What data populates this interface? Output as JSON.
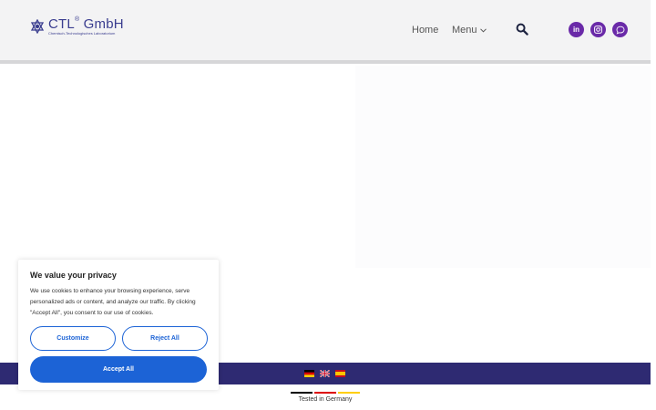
{
  "header": {
    "logo": {
      "title": "CTL",
      "registered": "®",
      "suffix": " GmbH",
      "subtitle": "Chemisch-Technologisches Laboratorium"
    },
    "nav": {
      "home": "Home",
      "menu": "Menu"
    },
    "icons": {
      "search": "search-icon",
      "linkedin": "linkedin-icon",
      "instagram": "instagram-icon",
      "chat": "chat-icon"
    },
    "linkedin_label": "in"
  },
  "colors": {
    "brand": "#3a3d8f",
    "social": "#6a2aa8",
    "footer": "#2e2a72",
    "accent": "#1c63d6"
  },
  "footer": {
    "languages": [
      "de",
      "en",
      "es"
    ],
    "tested": "Tested in Germany"
  },
  "cookie_banner": {
    "title": "We value your privacy",
    "text": "We use cookies to enhance your browsing experience, serve personalized ads or content, and analyze our traffic. By clicking \"Accept All\", you consent to our use of cookies.",
    "customize": "Customize",
    "reject": "Reject All",
    "accept": "Accept All"
  }
}
